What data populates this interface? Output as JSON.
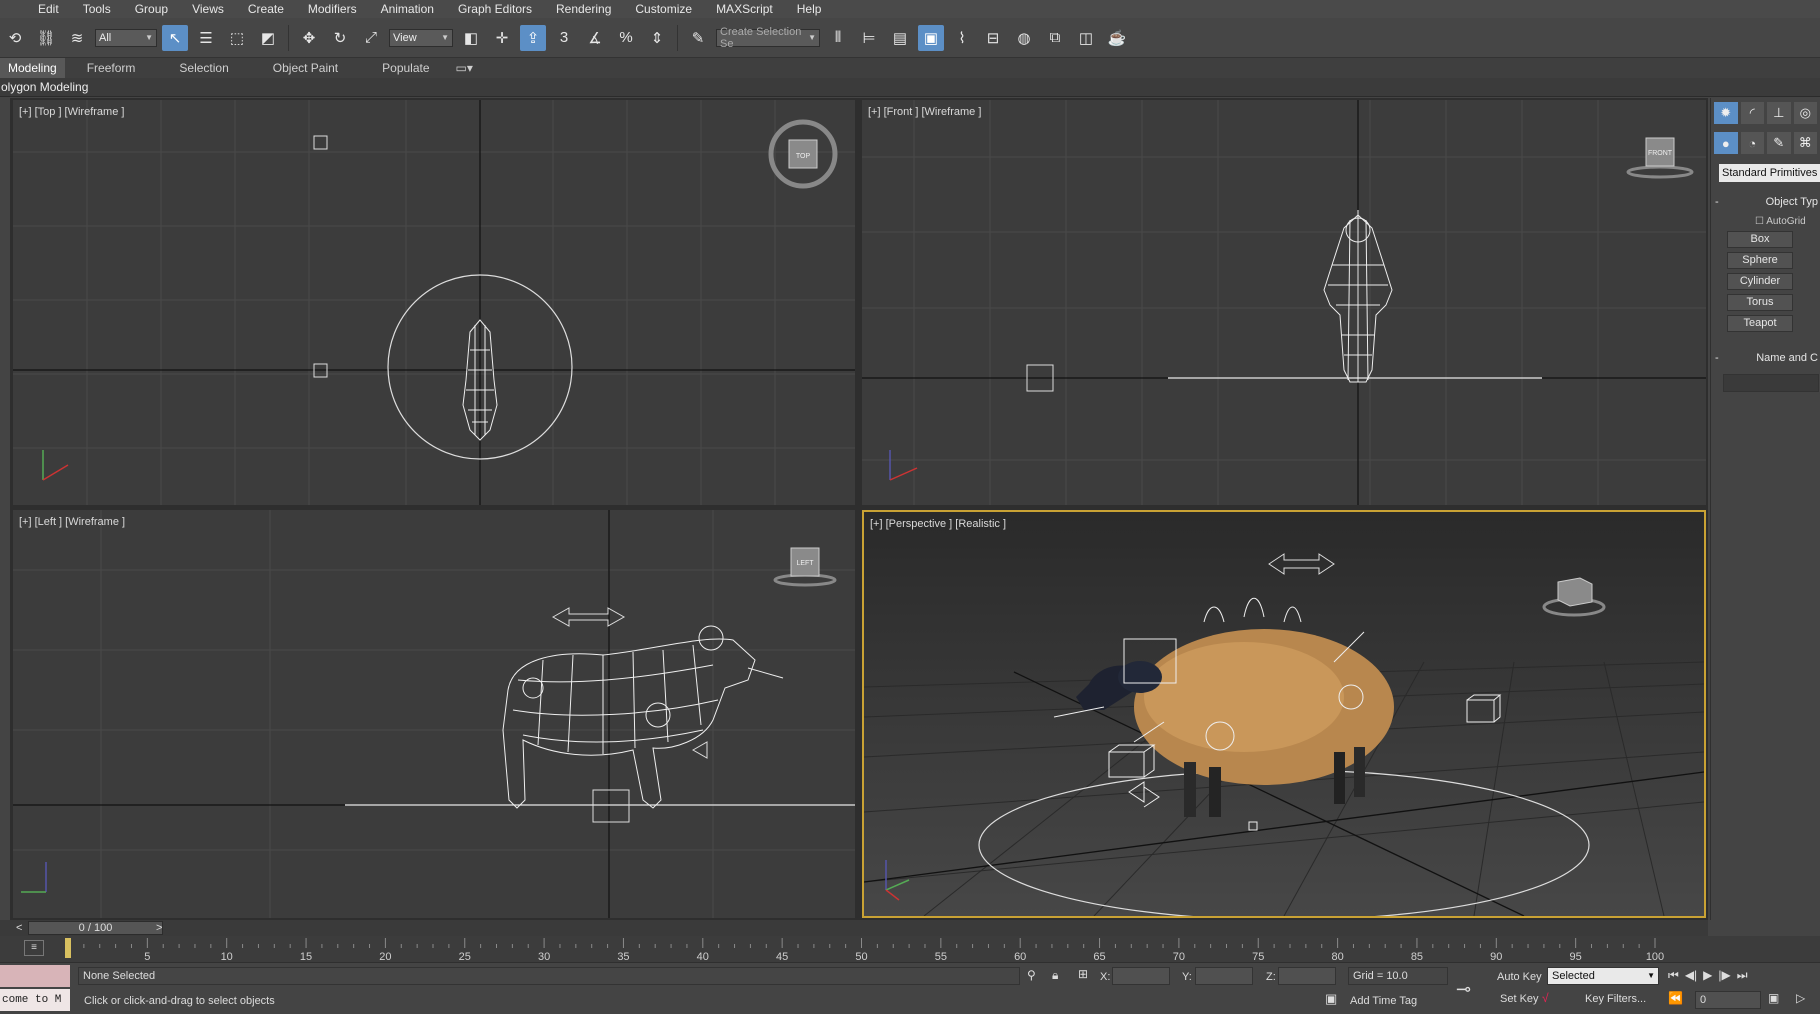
{
  "menu": [
    "Edit",
    "Tools",
    "Group",
    "Views",
    "Create",
    "Modifiers",
    "Animation",
    "Graph Editors",
    "Rendering",
    "Customize",
    "MAXScript",
    "Help"
  ],
  "toolbar": {
    "filter_value": "All",
    "ref_coord_value": "View",
    "selection_set_placeholder": "Create Selection Se",
    "snap_labels": [
      "3",
      "%"
    ]
  },
  "ribbon": {
    "tabs": [
      "Modeling",
      "Freeform",
      "Selection",
      "Object Paint",
      "Populate"
    ],
    "subtitle": "olygon Modeling"
  },
  "viewports": {
    "top": {
      "label": "[+] [Top ] [Wireframe ]",
      "cube": "TOP"
    },
    "front": {
      "label": "[+] [Front ] [Wireframe ]",
      "cube": "FRONT"
    },
    "left": {
      "label": "[+] [Left ] [Wireframe ]",
      "cube": "LEFT"
    },
    "perspective": {
      "label": "[+] [Perspective ] [Realistic ]"
    }
  },
  "command_panel": {
    "category": "Standard Primitives",
    "rollout_object_type": "Object Typ",
    "autogrid": "AutoGrid",
    "buttons": [
      "Box",
      "Sphere",
      "Cylinder",
      "Torus",
      "Teapot"
    ],
    "right_buttons_partial": [
      "",
      "G",
      "",
      "",
      ""
    ],
    "rollout_name": "Name and C"
  },
  "timeline": {
    "frame": "0 / 100",
    "ticks": [
      "5",
      "10",
      "15",
      "20",
      "25",
      "30",
      "35",
      "40",
      "45",
      "50",
      "55",
      "60",
      "65",
      "70",
      "75",
      "80",
      "85",
      "90",
      "95",
      "100"
    ]
  },
  "status": {
    "selection": "None Selected",
    "prompt": "Click or click-and-drag to select objects",
    "maxscript": "come to M",
    "x_label": "X:",
    "y_label": "Y:",
    "z_label": "Z:",
    "grid": "Grid = 10.0",
    "add_time_tag": "Add Time Tag",
    "auto_key": "Auto Key",
    "set_key": "Set Key",
    "key_mode": "Selected",
    "key_filters": "Key Filters...",
    "current_frame": "0"
  }
}
